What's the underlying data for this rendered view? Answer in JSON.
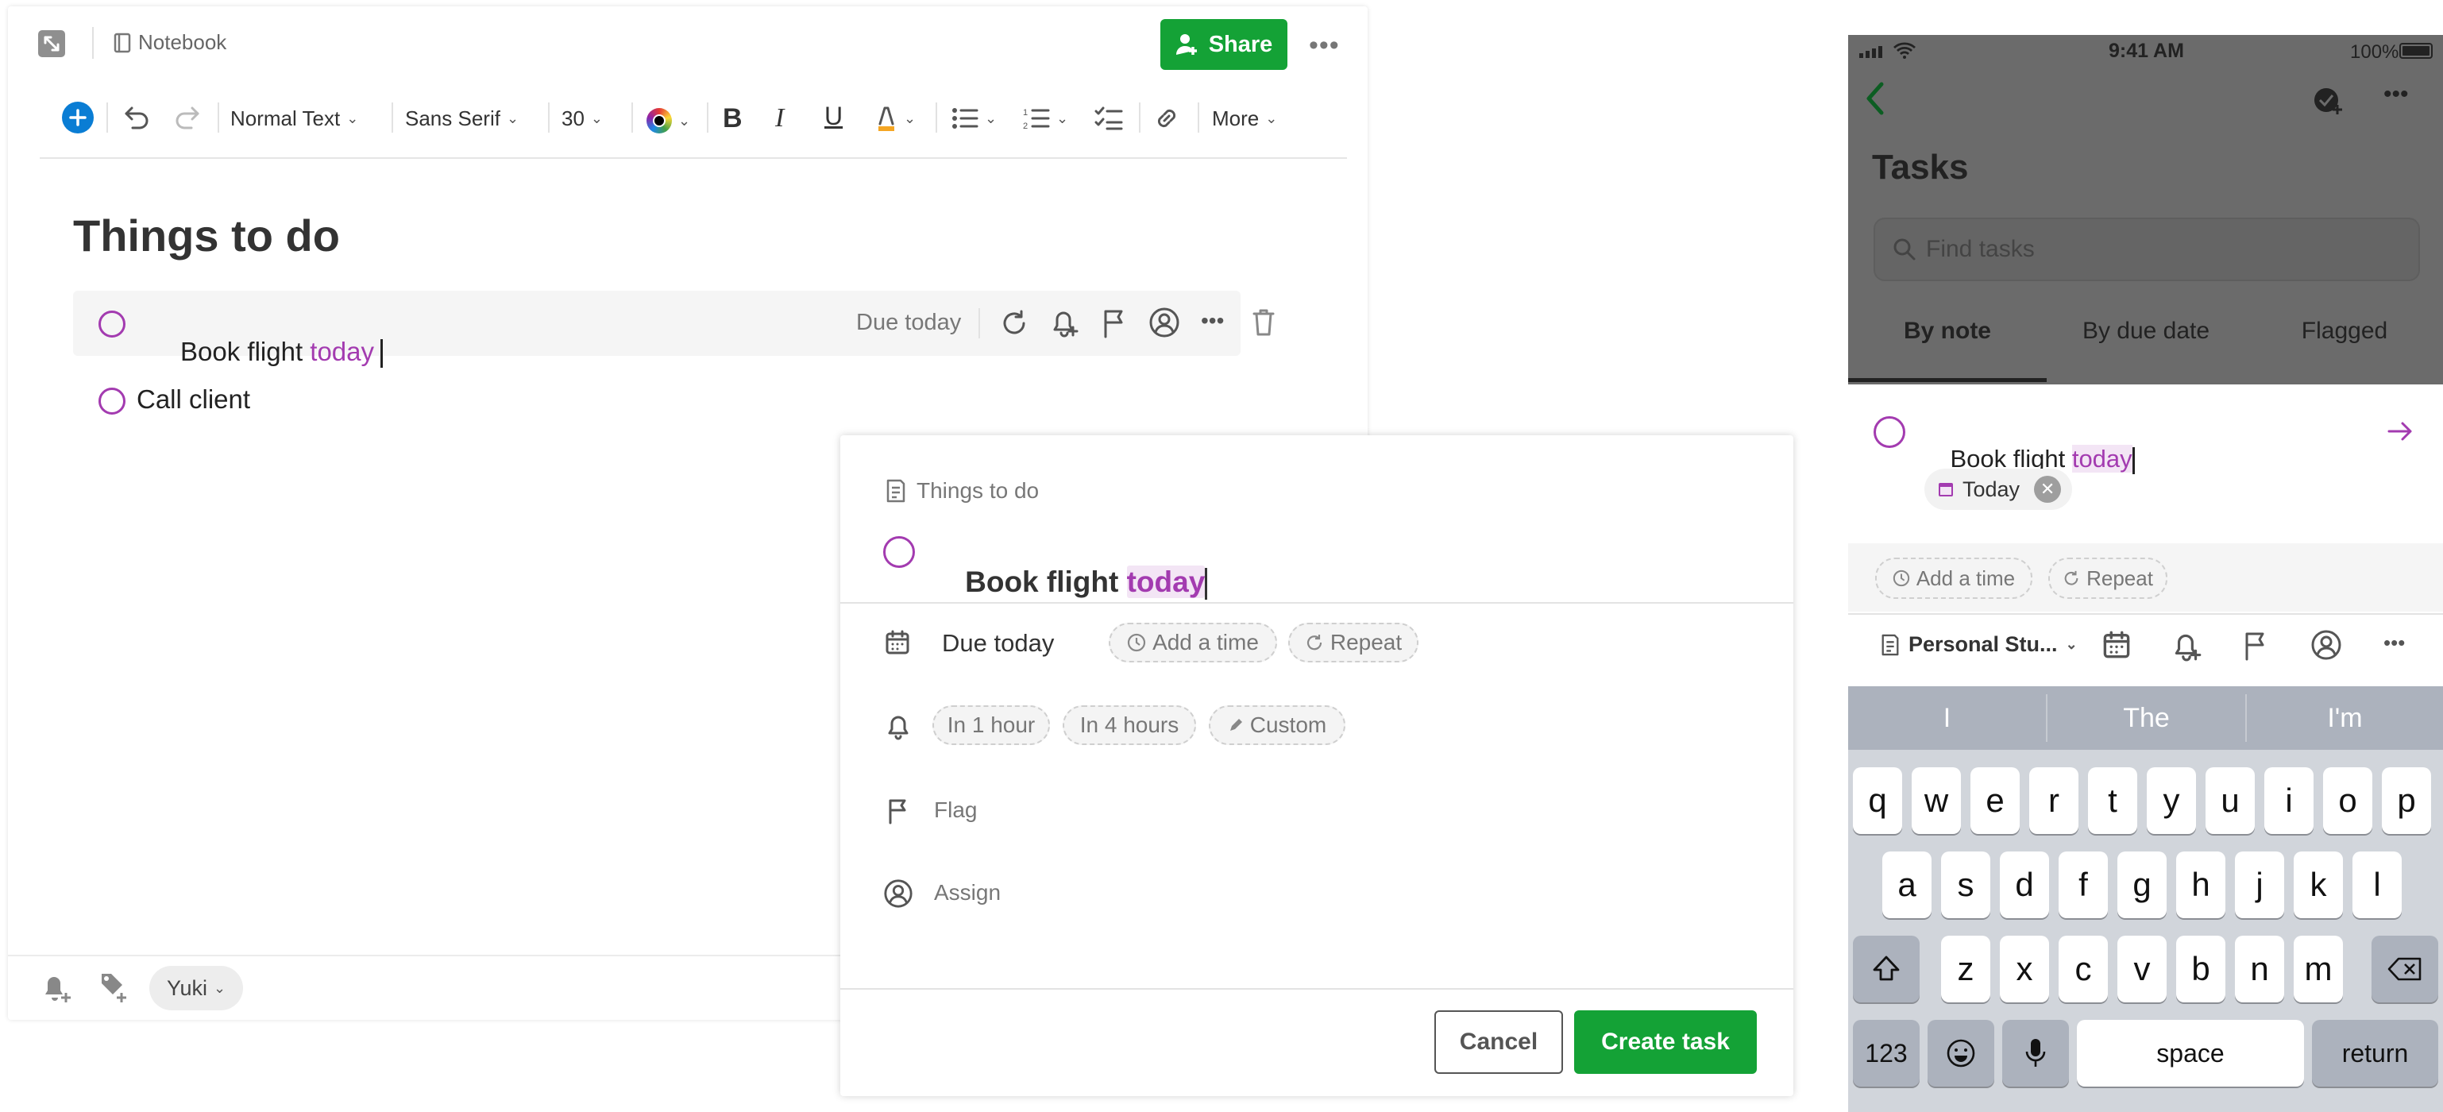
{
  "editor": {
    "breadcrumb": "Notebook",
    "share_label": "Share",
    "toolbar": {
      "text_style": "Normal Text",
      "font": "Sans Serif",
      "font_size": "30",
      "more_label": "More"
    },
    "note_title": "Things to do",
    "tasks": [
      {
        "text": "Book flight ",
        "highlight": "today",
        "due": "Due today"
      },
      {
        "text": "Call client"
      }
    ],
    "user_chip": "Yuki"
  },
  "modal": {
    "note_name": "Things to do",
    "task_text": "Book flight ",
    "task_highlight": "today",
    "due_label": "Due today",
    "add_time_label": "Add a time",
    "repeat_label": "Repeat",
    "reminders": [
      "In 1 hour",
      "In 4 hours",
      "Custom"
    ],
    "flag_label": "Flag",
    "assign_label": "Assign",
    "cancel_label": "Cancel",
    "create_label": "Create task"
  },
  "phone": {
    "status": {
      "time": "9:41 AM",
      "battery": "100%"
    },
    "title": "Tasks",
    "search_placeholder": "Find tasks",
    "tabs": [
      "By note",
      "By due date",
      "Flagged"
    ],
    "task_text": "Book flight ",
    "task_highlight": "today",
    "date_chip": "Today",
    "add_time_label": "Add a time",
    "repeat_label": "Repeat",
    "notebook": "Personal Stu...",
    "suggestions": [
      "I",
      "The",
      "I'm"
    ],
    "keys_row1": [
      "q",
      "w",
      "e",
      "r",
      "t",
      "y",
      "u",
      "i",
      "o",
      "p"
    ],
    "keys_row2": [
      "a",
      "s",
      "d",
      "f",
      "g",
      "h",
      "j",
      "k",
      "l"
    ],
    "keys_row3": [
      "z",
      "x",
      "c",
      "v",
      "b",
      "n",
      "m"
    ],
    "key_123": "123",
    "key_space": "space",
    "key_return": "return"
  },
  "colors": {
    "accent_green": "#14a236",
    "task_purple": "#a33bb0",
    "add_blue": "#0a7dd4"
  }
}
